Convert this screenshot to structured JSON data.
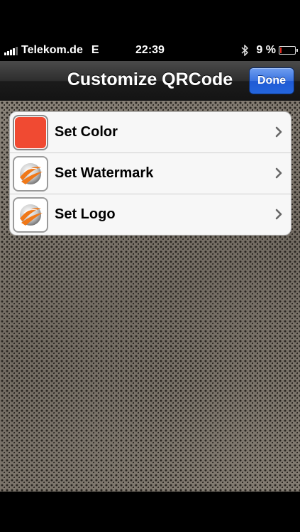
{
  "status_bar": {
    "carrier": "Telekom.de",
    "network": "E",
    "time": "22:39",
    "battery_percent": "9 %",
    "battery_level": 0.09
  },
  "nav": {
    "title": "Customize QRCode",
    "done_label": "Done"
  },
  "rows": [
    {
      "label": "Set Color",
      "icon": "color-swatch",
      "swatch_color": "#f04a32"
    },
    {
      "label": "Set Watermark",
      "icon": "globe-logo-icon"
    },
    {
      "label": "Set Logo",
      "icon": "globe-logo-icon"
    }
  ],
  "colors": {
    "done_button": "#2466dd",
    "swatch": "#f04a32",
    "logo_orange": "#f07818"
  }
}
